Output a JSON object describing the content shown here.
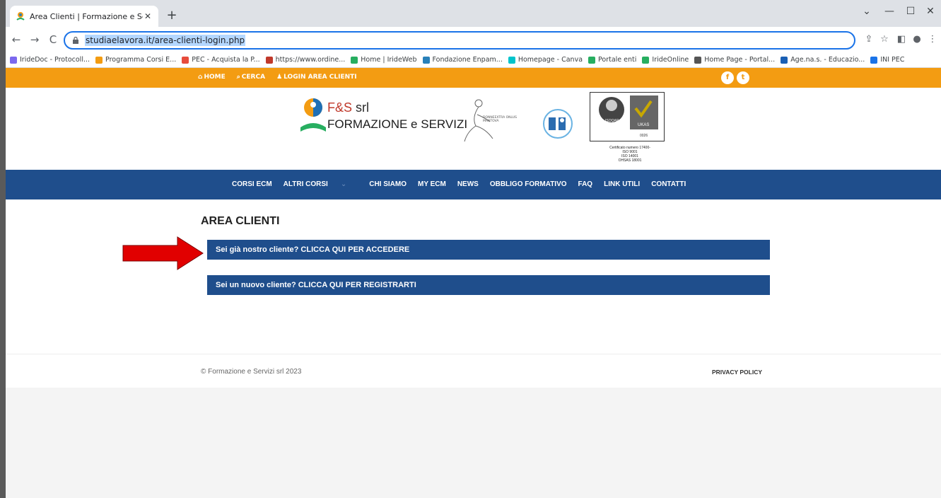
{
  "browser": {
    "tab_title": "Area Clienti | Formazione e Servi",
    "tab_close": "✕",
    "new_tab": "+",
    "url": "studiaelavora.it/area-clienti-login.php",
    "window_controls": [
      "⌄",
      "—",
      "☐",
      "✕"
    ],
    "bookmarks": [
      {
        "label": "IrideDoc - Protocoll...",
        "color": "#7b68ee"
      },
      {
        "label": "Programma Corsi E...",
        "color": "#f39c12"
      },
      {
        "label": "PEC - Acquista la P...",
        "color": "#e74c3c"
      },
      {
        "label": "https://www.ordine...",
        "color": "#c0392b"
      },
      {
        "label": "Home | IrideWeb",
        "color": "#27ae60"
      },
      {
        "label": "Fondazione Enpam...",
        "color": "#2980b9"
      },
      {
        "label": "Homepage - Canva",
        "color": "#00c4cc"
      },
      {
        "label": "Portale enti",
        "color": "#27ae60"
      },
      {
        "label": "IrideOnline",
        "color": "#27ae60"
      },
      {
        "label": "Home Page - Portal...",
        "color": "#555555"
      },
      {
        "label": "Age.na.s. - Educazio...",
        "color": "#1a5fb4"
      },
      {
        "label": "INI PEC",
        "color": "#1a73e8"
      }
    ]
  },
  "site": {
    "topbar": {
      "home": "HOME",
      "search": "CERCA",
      "login": "LOGIN AREA CLIENTI",
      "facebook": "f",
      "twitter": "t"
    },
    "logo": {
      "brand": "F&S",
      "srl": " srl",
      "subtitle": "FORMAZIONE e SERVIZI"
    },
    "donne_text": "DONNEEXTRA ONLUS MANTOVA",
    "cert_badge": {
      "isoqar": "ISOQAR",
      "ukas": "UKAS",
      "number": "0026"
    },
    "cert_text": {
      "line1": "Certificato numero 17400-",
      "line2": "ISO 9001",
      "line3": "ISO 14001",
      "line4": "OHSAS 18001"
    },
    "nav": [
      "CORSI ECM",
      "ALTRI CORSI",
      "CHI SIAMO",
      "MY ECM",
      "NEWS",
      "OBBLIGO FORMATIVO",
      "FAQ",
      "LINK UTILI",
      "CONTATTI"
    ],
    "page_title": "AREA CLIENTI",
    "login_cta": "Sei già nostro cliente? CLICCA QUI PER ACCEDERE",
    "register_cta": "Sei un nuovo cliente? CLICCA QUI PER REGISTRARTI",
    "copyright": "© Formazione e Servizi srl 2023",
    "privacy": "PRIVACY POLICY"
  },
  "colors": {
    "orange": "#f39c12",
    "navy": "#1f4e8c",
    "arrow": "#e10000"
  }
}
